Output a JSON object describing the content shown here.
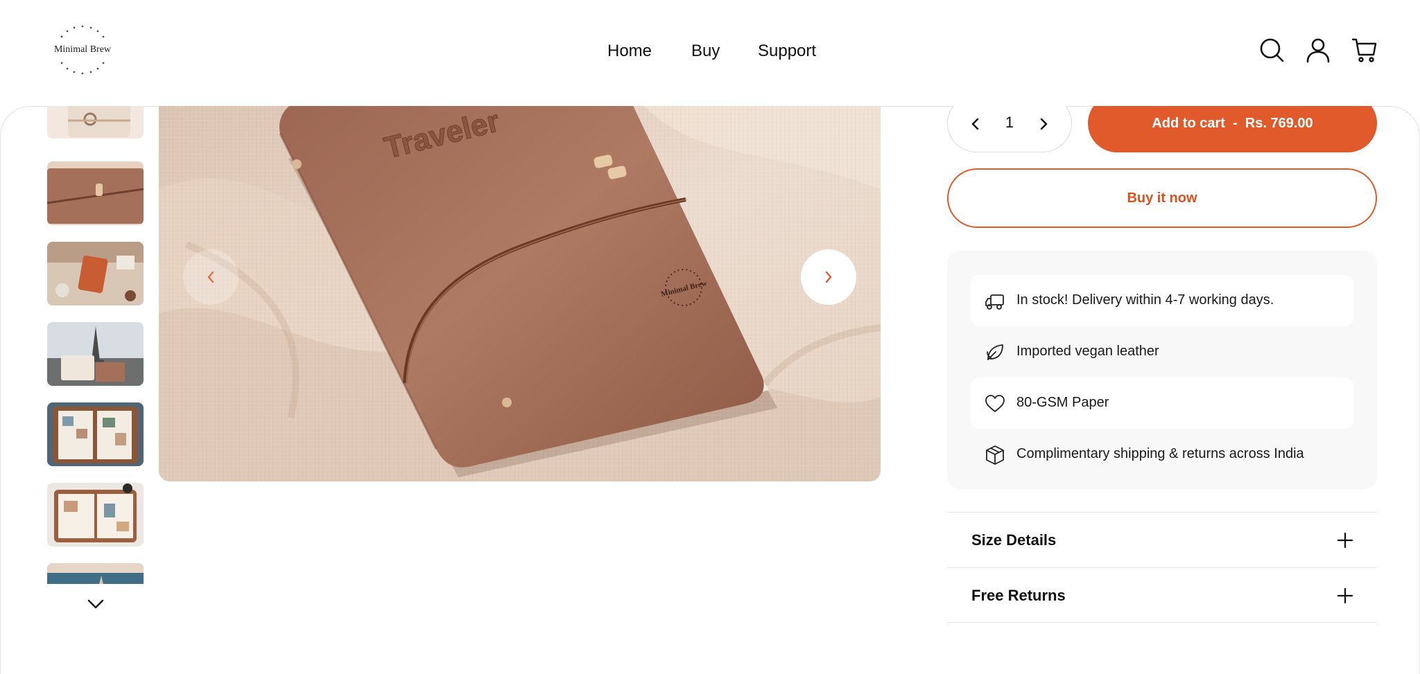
{
  "brand": {
    "name": "Minimal Brew"
  },
  "nav": {
    "items": [
      "Home",
      "Buy",
      "Support"
    ]
  },
  "header_icons": [
    "search-icon",
    "account-icon",
    "cart-icon"
  ],
  "gallery": {
    "hero_title_text": "Traveler",
    "hero_logo_text": "Minimal Brew",
    "thumbnail_count": 7
  },
  "purchase": {
    "quantity": "1",
    "add_to_cart_label": "Add to cart  -  Rs. 769.00",
    "buy_now_label": "Buy it now"
  },
  "features": [
    {
      "icon": "delivery-truck-icon",
      "text": "In stock! Delivery within 4-7 working days."
    },
    {
      "icon": "leaf-icon",
      "text": "Imported vegan leather"
    },
    {
      "icon": "heart-icon",
      "text": "80-GSM Paper"
    },
    {
      "icon": "box-icon",
      "text": "Complimentary shipping & returns across India"
    }
  ],
  "accordions": [
    {
      "title": "Size Details"
    },
    {
      "title": "Free Returns"
    }
  ],
  "colors": {
    "accent": "#e05a2b",
    "leather": "#a5705a",
    "fabric": "#ead8c8",
    "feature_bg": "#f8f8f8"
  }
}
